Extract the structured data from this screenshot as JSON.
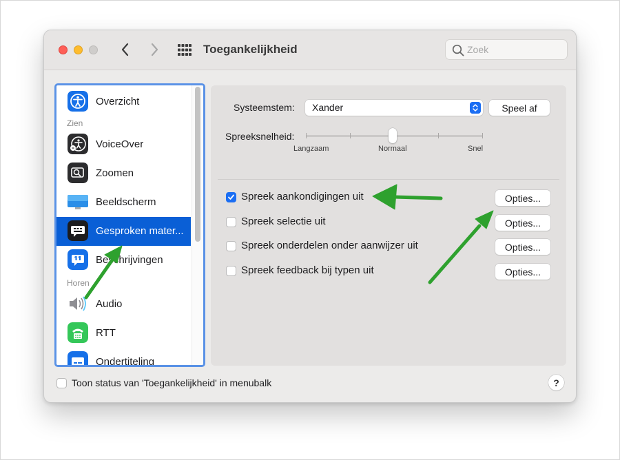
{
  "window": {
    "title": "Toegankelijkheid",
    "search": {
      "placeholder": "Zoek",
      "value": ""
    }
  },
  "sidebar": {
    "items": [
      {
        "label": "Overzicht",
        "icon": "accessibility-icon"
      },
      {
        "label": "VoiceOver",
        "icon": "voiceover-icon"
      },
      {
        "label": "Zoomen",
        "icon": "zoom-icon"
      },
      {
        "label": "Beeldscherm",
        "icon": "display-icon"
      },
      {
        "label": "Gesproken mater...",
        "icon": "spoken-content-icon",
        "selected": true
      },
      {
        "label": "Beschrijvingen",
        "icon": "descriptions-icon"
      },
      {
        "label": "Audio",
        "icon": "speaker-icon"
      },
      {
        "label": "RTT",
        "icon": "rtt-icon"
      },
      {
        "label": "Ondertiteling",
        "icon": "captions-icon"
      }
    ],
    "sections": {
      "seeing": "Zien",
      "hearing": "Horen"
    }
  },
  "content": {
    "system_voice_label": "Systeemstem:",
    "system_voice_value": "Xander",
    "play_button": "Speel af",
    "speaking_rate_label": "Spreeksnelheid:",
    "speaking_rate_level": 0.5,
    "rate_ticks": {
      "slow": "Langzaam",
      "normal": "Normaal",
      "fast": "Snel"
    },
    "options": [
      {
        "label": "Spreek aankondigingen uit",
        "checked": true,
        "button": "Opties..."
      },
      {
        "label": "Spreek selectie uit",
        "checked": false,
        "button": "Opties..."
      },
      {
        "label": "Spreek onderdelen onder aanwijzer uit",
        "checked": false,
        "button": "Opties..."
      },
      {
        "label": "Spreek feedback bij typen uit",
        "checked": false,
        "button": "Opties..."
      }
    ]
  },
  "footer": {
    "menubar_status_label": "Toon status van 'Toegankelijkheid' in menubalk",
    "menubar_status_checked": false,
    "help_label": "?"
  },
  "colors": {
    "accent": "#1b6ef3",
    "selection": "#0a5fd6",
    "annotation_arrow": "#2ea12e"
  }
}
